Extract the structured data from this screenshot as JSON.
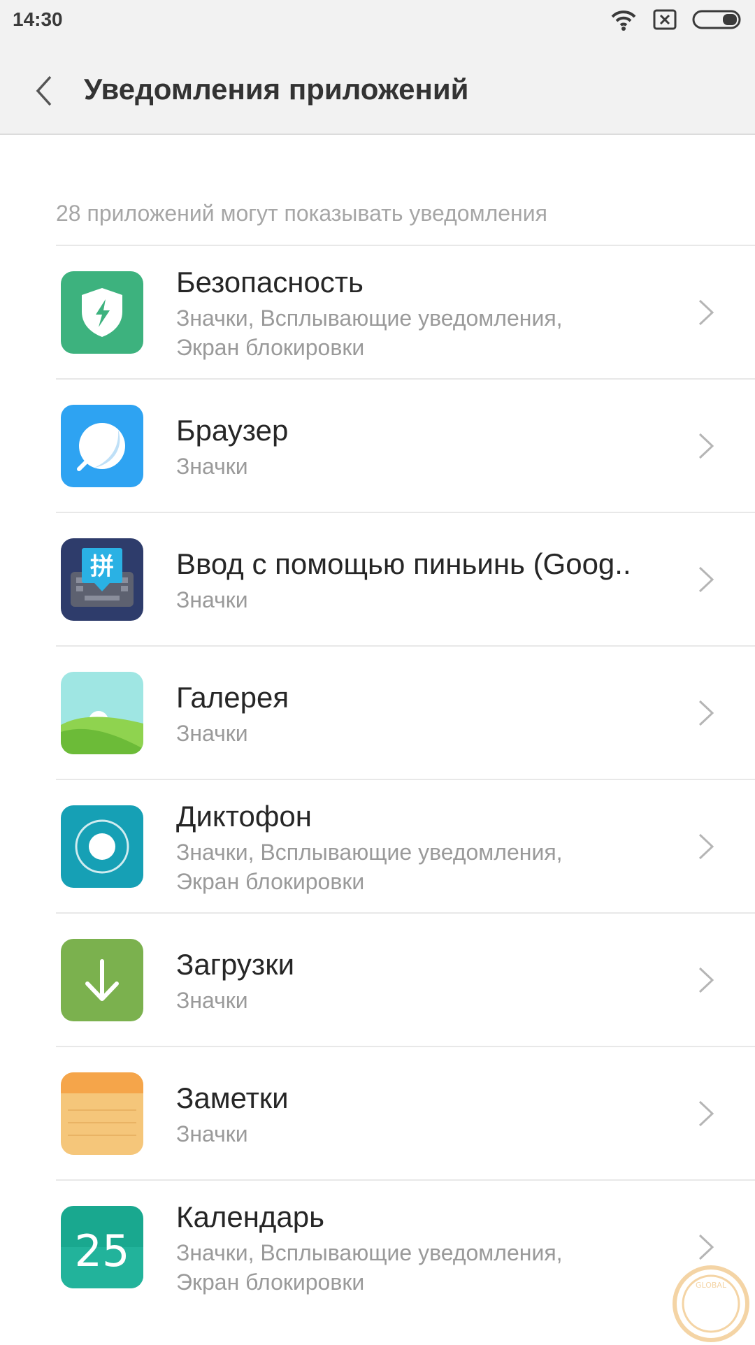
{
  "status": {
    "time": "14:30",
    "icons": [
      "wifi-icon",
      "sim-card-icon",
      "battery-icon"
    ]
  },
  "header": {
    "back_icon": "chevron-left-icon",
    "title": "Уведомления приложений"
  },
  "section_caption": "28 приложений могут показывать уведомления",
  "apps": [
    {
      "name": "Безопасность",
      "desc": "Значки, Всплывающие уведомления,\nЭкран блокировки",
      "icon": "shield-icon",
      "color": "#3db27e"
    },
    {
      "name": "Браузер",
      "desc": "Значки",
      "icon": "browser-icon",
      "color": "#2ea3f2"
    },
    {
      "name": "Ввод с помощью пиньинь (Goog..",
      "desc": "Значки",
      "icon": "keyboard-icon",
      "color": "#2e3c6b",
      "icon_glyph": "拼"
    },
    {
      "name": "Галерея",
      "desc": "Значки",
      "icon": "gallery-icon",
      "color": "#8bd14f"
    },
    {
      "name": "Диктофон",
      "desc": "Значки, Всплывающие уведомления,\nЭкран блокировки",
      "icon": "recorder-icon",
      "color": "#16a0b5"
    },
    {
      "name": "Загрузки",
      "desc": "Значки",
      "icon": "download-icon",
      "color": "#7bb14e"
    },
    {
      "name": "Заметки",
      "desc": "Значки",
      "icon": "notes-icon",
      "color": "#f5c67a"
    },
    {
      "name": "Календарь",
      "desc": "Значки, Всплывающие уведомления,\nЭкран блокировки",
      "icon": "calendar-icon",
      "color": "#19a88f",
      "icon_glyph": "25"
    }
  ],
  "watermark_text": "GLOBAL"
}
